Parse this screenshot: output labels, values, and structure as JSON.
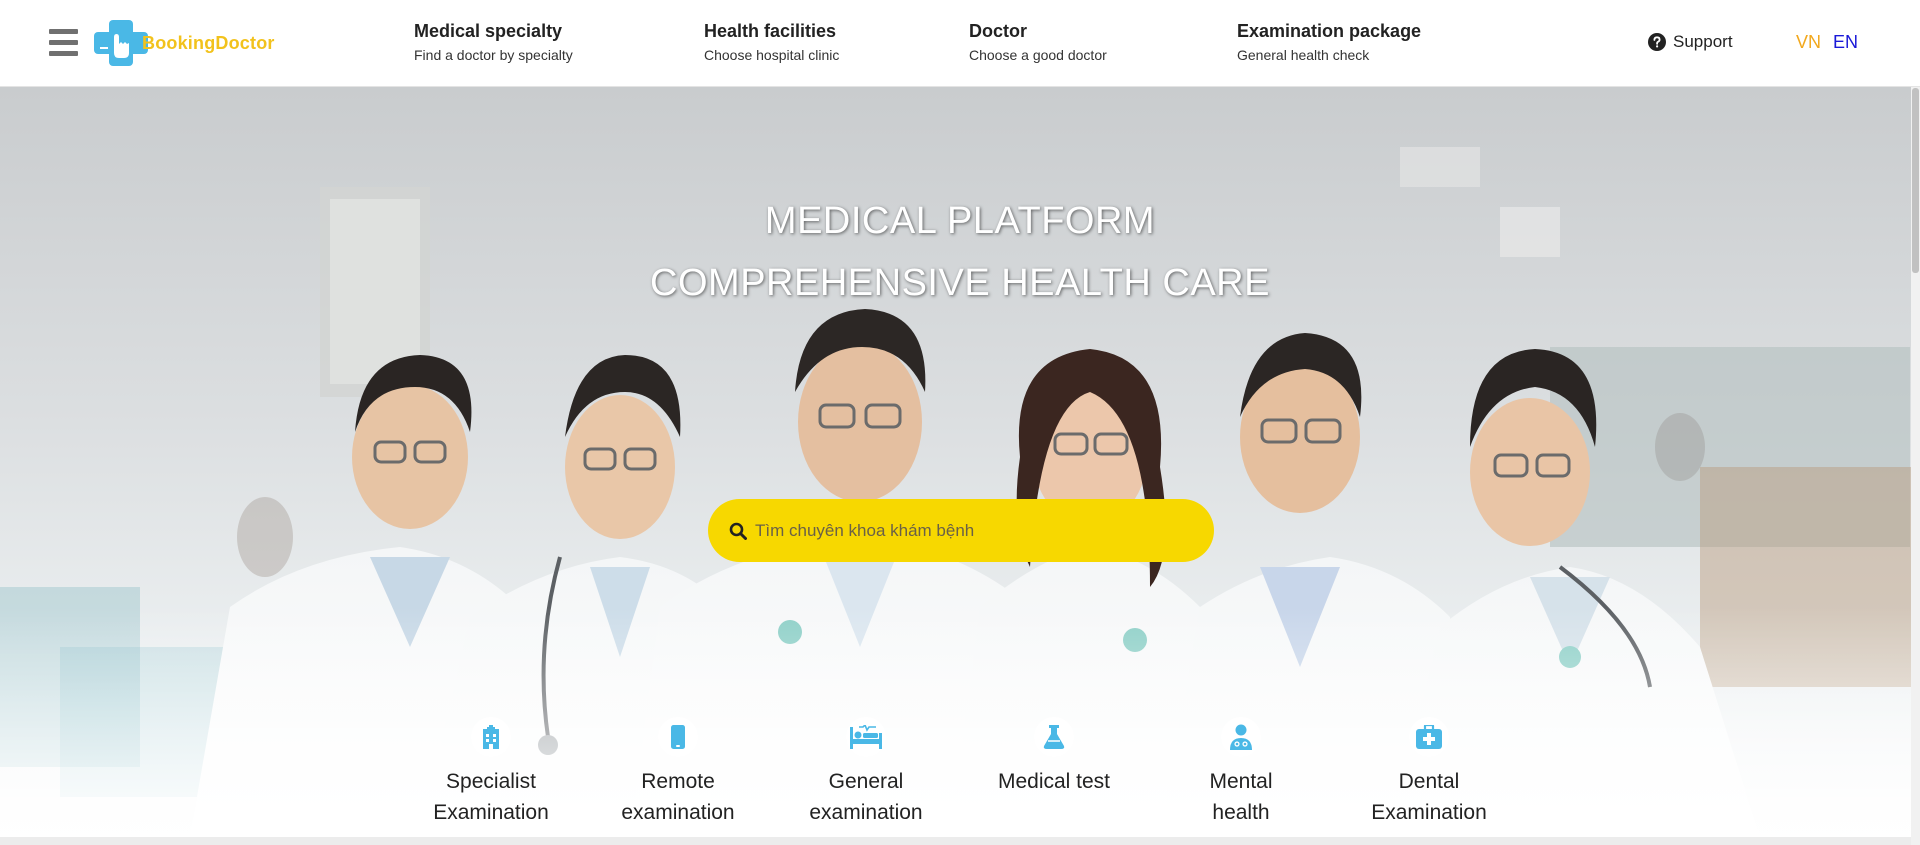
{
  "header": {
    "logo_text": "BookingDoctor",
    "menu_icon": "hamburger-menu-icon",
    "nav": [
      {
        "title": "Medical specialty",
        "subtitle": "Find a doctor by specialty"
      },
      {
        "title": "Health facilities",
        "subtitle": "Choose hospital clinic"
      },
      {
        "title": "Doctor",
        "subtitle": "Choose a good doctor"
      },
      {
        "title": "Examination package",
        "subtitle": "General health check"
      }
    ],
    "support": {
      "label": "Support",
      "icon": "question-circle-icon"
    },
    "languages": [
      {
        "code": "VN",
        "color": "#f2a81d",
        "active": true
      },
      {
        "code": "EN",
        "color": "#1a19d8",
        "active": false
      }
    ]
  },
  "hero": {
    "headline_1": "MEDICAL PLATFORM",
    "headline_2": "COMPREHENSIVE HEALTH CARE",
    "search": {
      "placeholder": "Tìm chuyên khoa khám bệnh",
      "value": "",
      "icon": "search-icon",
      "color": "#f7d800"
    }
  },
  "services": [
    {
      "line1": "Specialist",
      "line2": "Examination",
      "icon": "hospital-building-icon"
    },
    {
      "line1": "Remote",
      "line2": "examination",
      "icon": "mobile-phone-icon"
    },
    {
      "line1": "General",
      "line2": "examination",
      "icon": "hospital-bed-icon"
    },
    {
      "line1": "Medical test",
      "line2": "",
      "icon": "flask-icon"
    },
    {
      "line1": "Mental",
      "line2": "health",
      "icon": "doctor-user-icon"
    },
    {
      "line1": "Dental",
      "line2": "Examination",
      "icon": "medical-kit-icon"
    }
  ],
  "colors": {
    "accent": "#4ab8e6",
    "search_bg": "#f7d800",
    "logo_text": "#f2c21c"
  }
}
